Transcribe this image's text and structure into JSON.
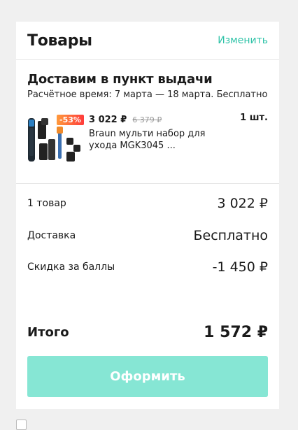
{
  "header": {
    "title": "Товары",
    "edit_label": "Изменить"
  },
  "delivery": {
    "title": "Доставим в пункт выдачи",
    "subtitle": "Расчётное время: 7 марта — 18 марта. Бесплатно"
  },
  "product": {
    "discount": "-53%",
    "price": "3 022 ₽",
    "old_price": "6 379 ₽",
    "name": "Braun мульти набор для ухода MGK3045 ...",
    "quantity": "1 шт.",
    "image_icon": "trimmer-kit-image"
  },
  "summary": {
    "items_label": "1 товар",
    "items_value": "3 022 ₽",
    "delivery_label": "Доставка",
    "delivery_value": "Бесплатно",
    "discount_label": "Скидка за баллы",
    "discount_value": "-1 450 ₽"
  },
  "total": {
    "label": "Итого",
    "value": "1 572 ₽"
  },
  "checkout": {
    "label": "Оформить"
  },
  "colors": {
    "accent": "#2fc3a8",
    "button": "#86e6d4",
    "badge_from": "#ff9a3c",
    "badge_to": "#ff3b3b"
  }
}
